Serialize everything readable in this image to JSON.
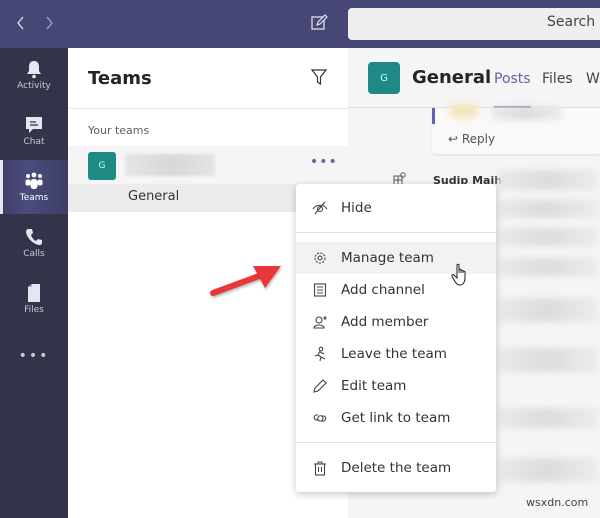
{
  "topbar": {
    "back_icon": "chevron-left-icon",
    "forward_icon": "chevron-right-icon",
    "compose_icon": "compose-icon",
    "search_placeholder": "Search o"
  },
  "rail": {
    "items": [
      {
        "label": "Activity",
        "icon": "bell-icon",
        "active": false
      },
      {
        "label": "Chat",
        "icon": "chat-icon",
        "active": false
      },
      {
        "label": "Teams",
        "icon": "teams-icon",
        "active": true
      },
      {
        "label": "Calls",
        "icon": "phone-icon",
        "active": false
      },
      {
        "label": "Files",
        "icon": "file-icon",
        "active": false
      }
    ],
    "more": "•••"
  },
  "panel": {
    "title": "Teams",
    "filter_icon": "filter-icon",
    "section_label": "Your teams",
    "team": {
      "avatar": "G",
      "more": "•••"
    },
    "channel": "General"
  },
  "main": {
    "channel_avatar": "G",
    "channel_title": "General",
    "tabs": [
      {
        "label": "Posts",
        "active": true
      },
      {
        "label": "Files",
        "active": false
      },
      {
        "label": "W",
        "active": false
      }
    ],
    "reply_label": "Reply",
    "sender": "Sudip Majhi"
  },
  "context_menu": {
    "items": [
      {
        "label": "Hide",
        "icon": "hide-icon"
      },
      {
        "label": "Manage team",
        "icon": "gear-icon",
        "hover": true
      },
      {
        "label": "Add channel",
        "icon": "channel-icon"
      },
      {
        "label": "Add member",
        "icon": "add-member-icon"
      },
      {
        "label": "Leave the team",
        "icon": "leave-icon"
      },
      {
        "label": "Edit team",
        "icon": "pencil-icon"
      },
      {
        "label": "Get link to team",
        "icon": "link-icon"
      },
      {
        "label": "Delete the team",
        "icon": "trash-icon"
      }
    ]
  },
  "annotation": {
    "arrow_color": "#e8373b"
  },
  "colors": {
    "brand": "#464775",
    "accent": "#6264a7",
    "team_avatar": "#1f8a85"
  },
  "watermark": "wsxdn.com"
}
